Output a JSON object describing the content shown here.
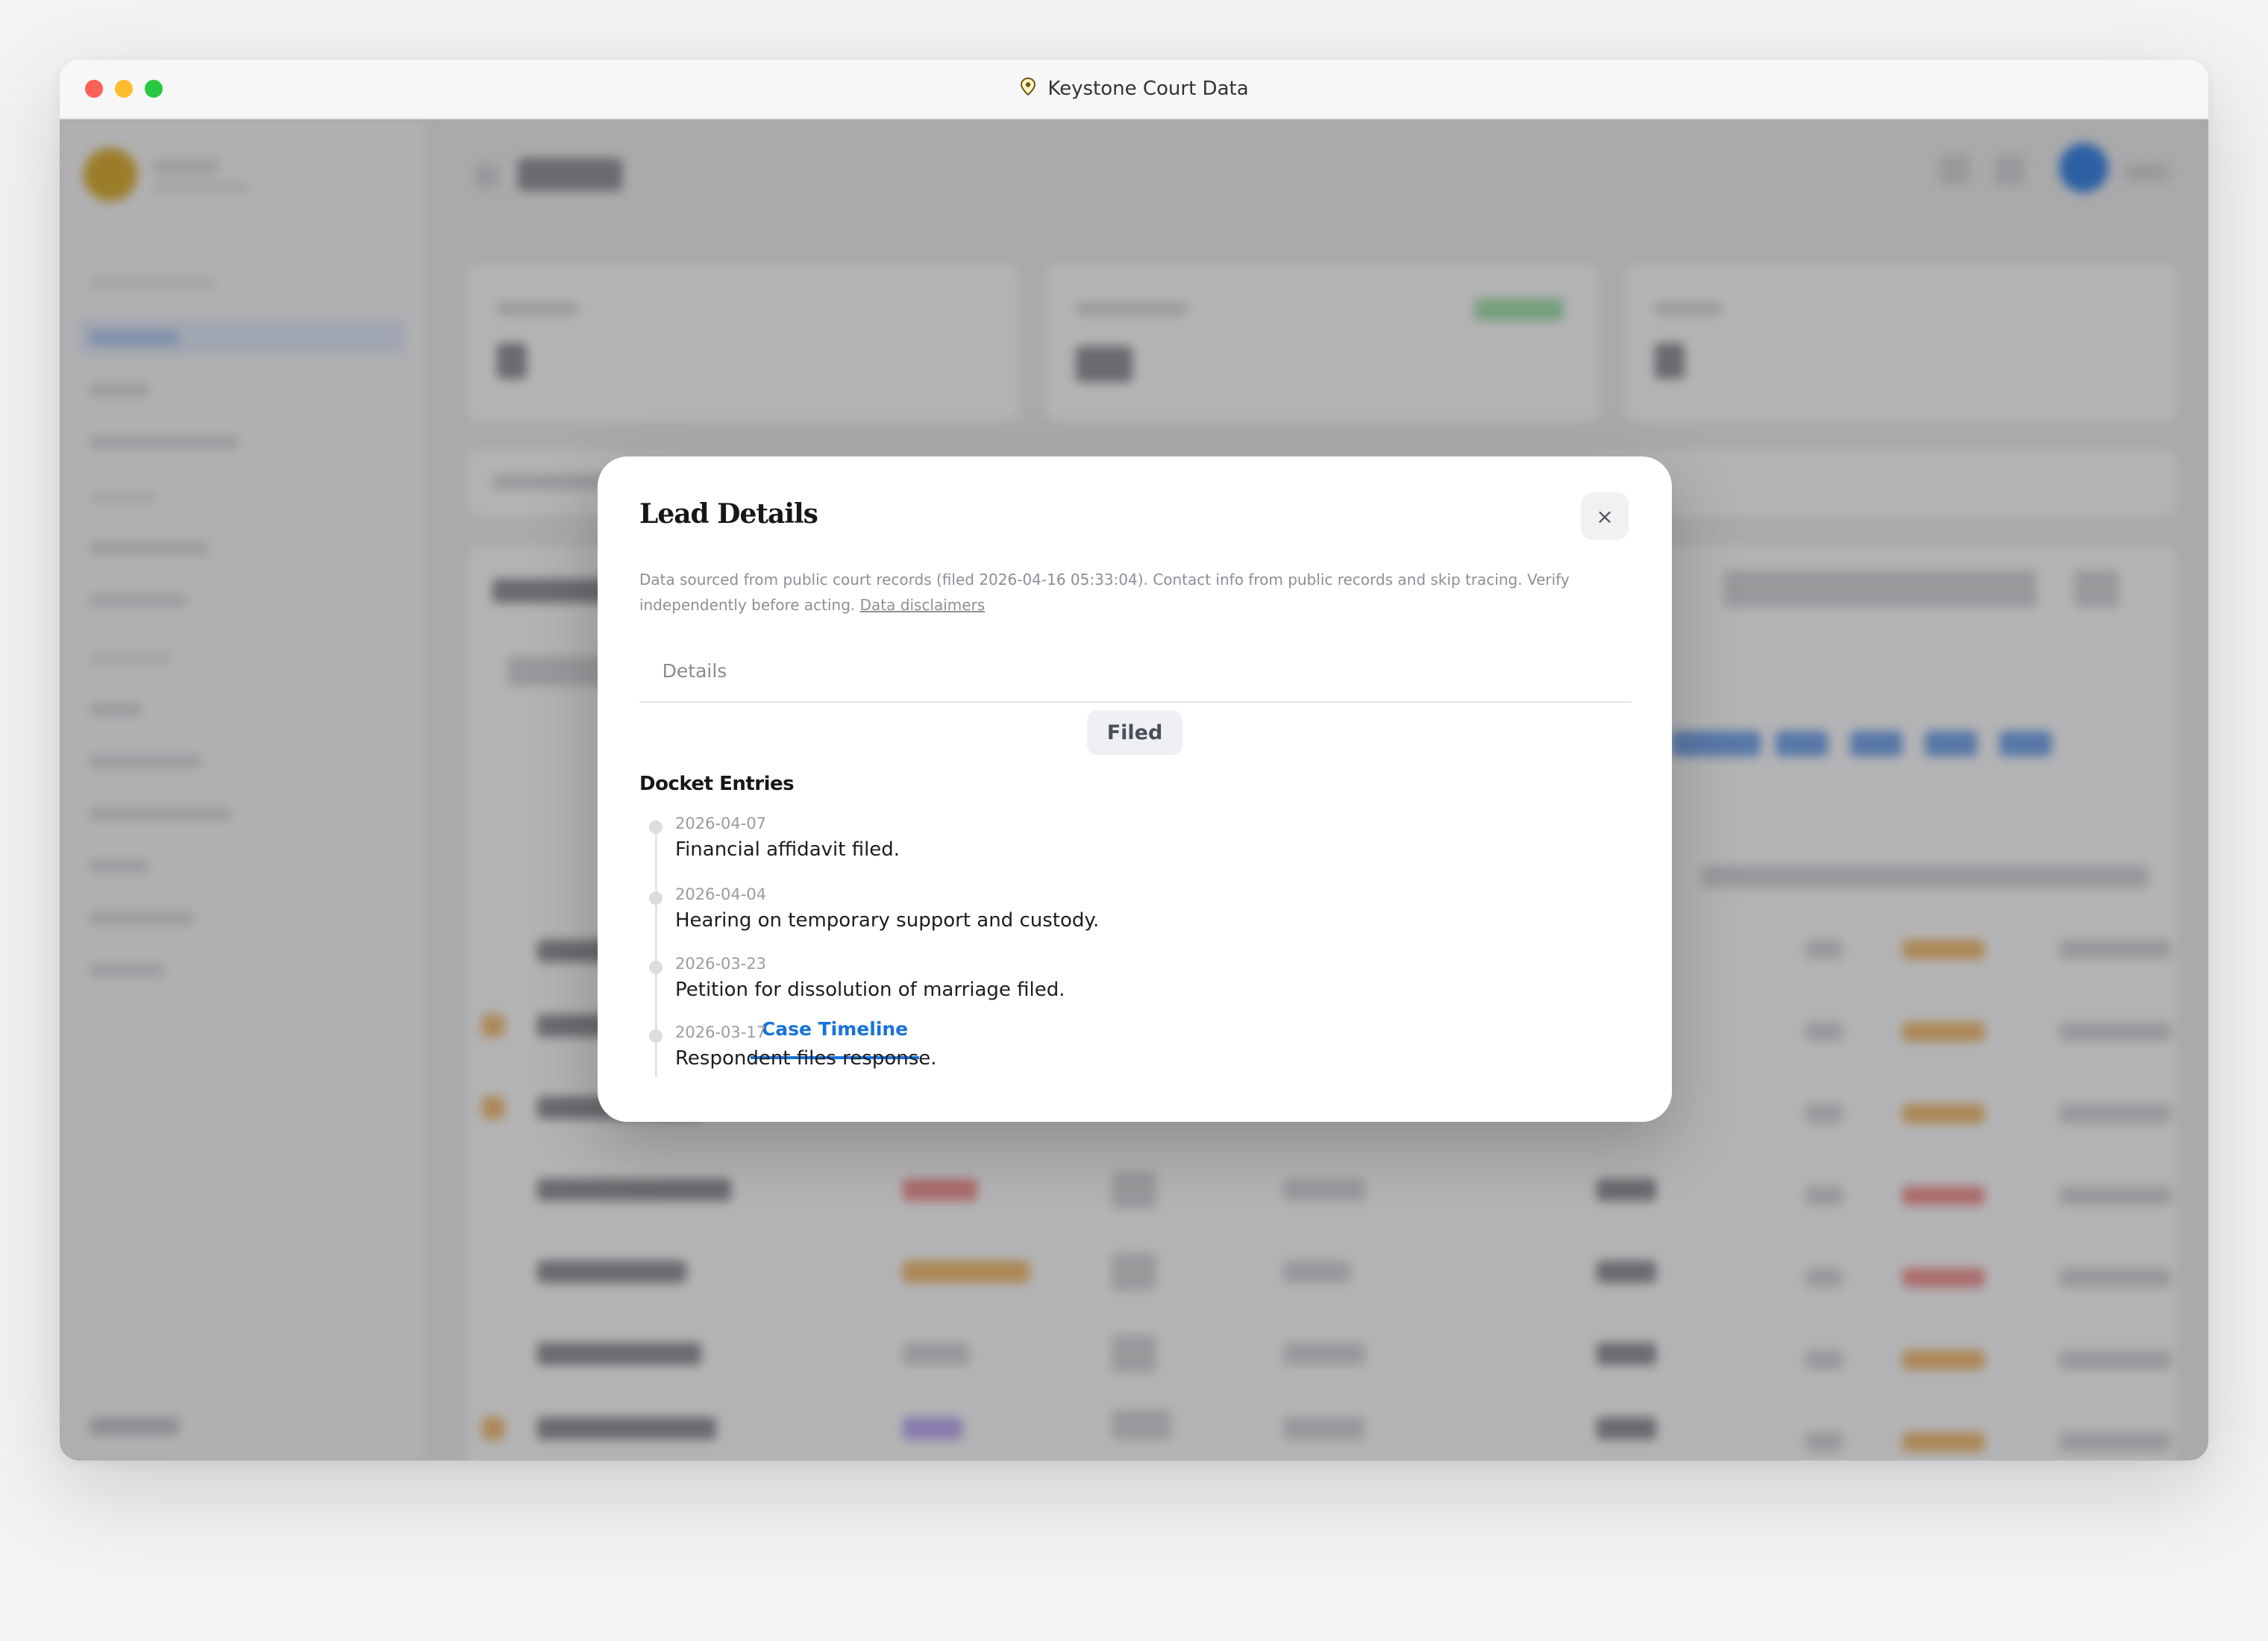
{
  "window": {
    "title": "Keystone Court Data",
    "logo_icon": "map-pin-icon"
  },
  "modal": {
    "title": "Lead Details",
    "close_label": "×",
    "disclaimer": "Data sourced from public court records (filed 2026-04-16 05:33:04). Contact info from public records and skip tracing. Verify independently before acting.",
    "disclaimer_link": "Data disclaimers",
    "tabs": [
      {
        "label": "Details",
        "active": false
      },
      {
        "label": "Case Timeline",
        "active": true
      }
    ],
    "status": "Filed",
    "section_title": "Docket Entries",
    "entries": [
      {
        "date": "2026-04-07",
        "text": "Financial affidavit filed."
      },
      {
        "date": "2026-04-04",
        "text": "Hearing on temporary support and custody."
      },
      {
        "date": "2026-03-23",
        "text": "Petition for dissolution of marriage filed."
      },
      {
        "date": "2026-03-17",
        "text": "Respondent files response."
      }
    ]
  },
  "colors": {
    "accent": "#1772da",
    "avatar": "#2f7de1",
    "logo": "#d7a928"
  }
}
